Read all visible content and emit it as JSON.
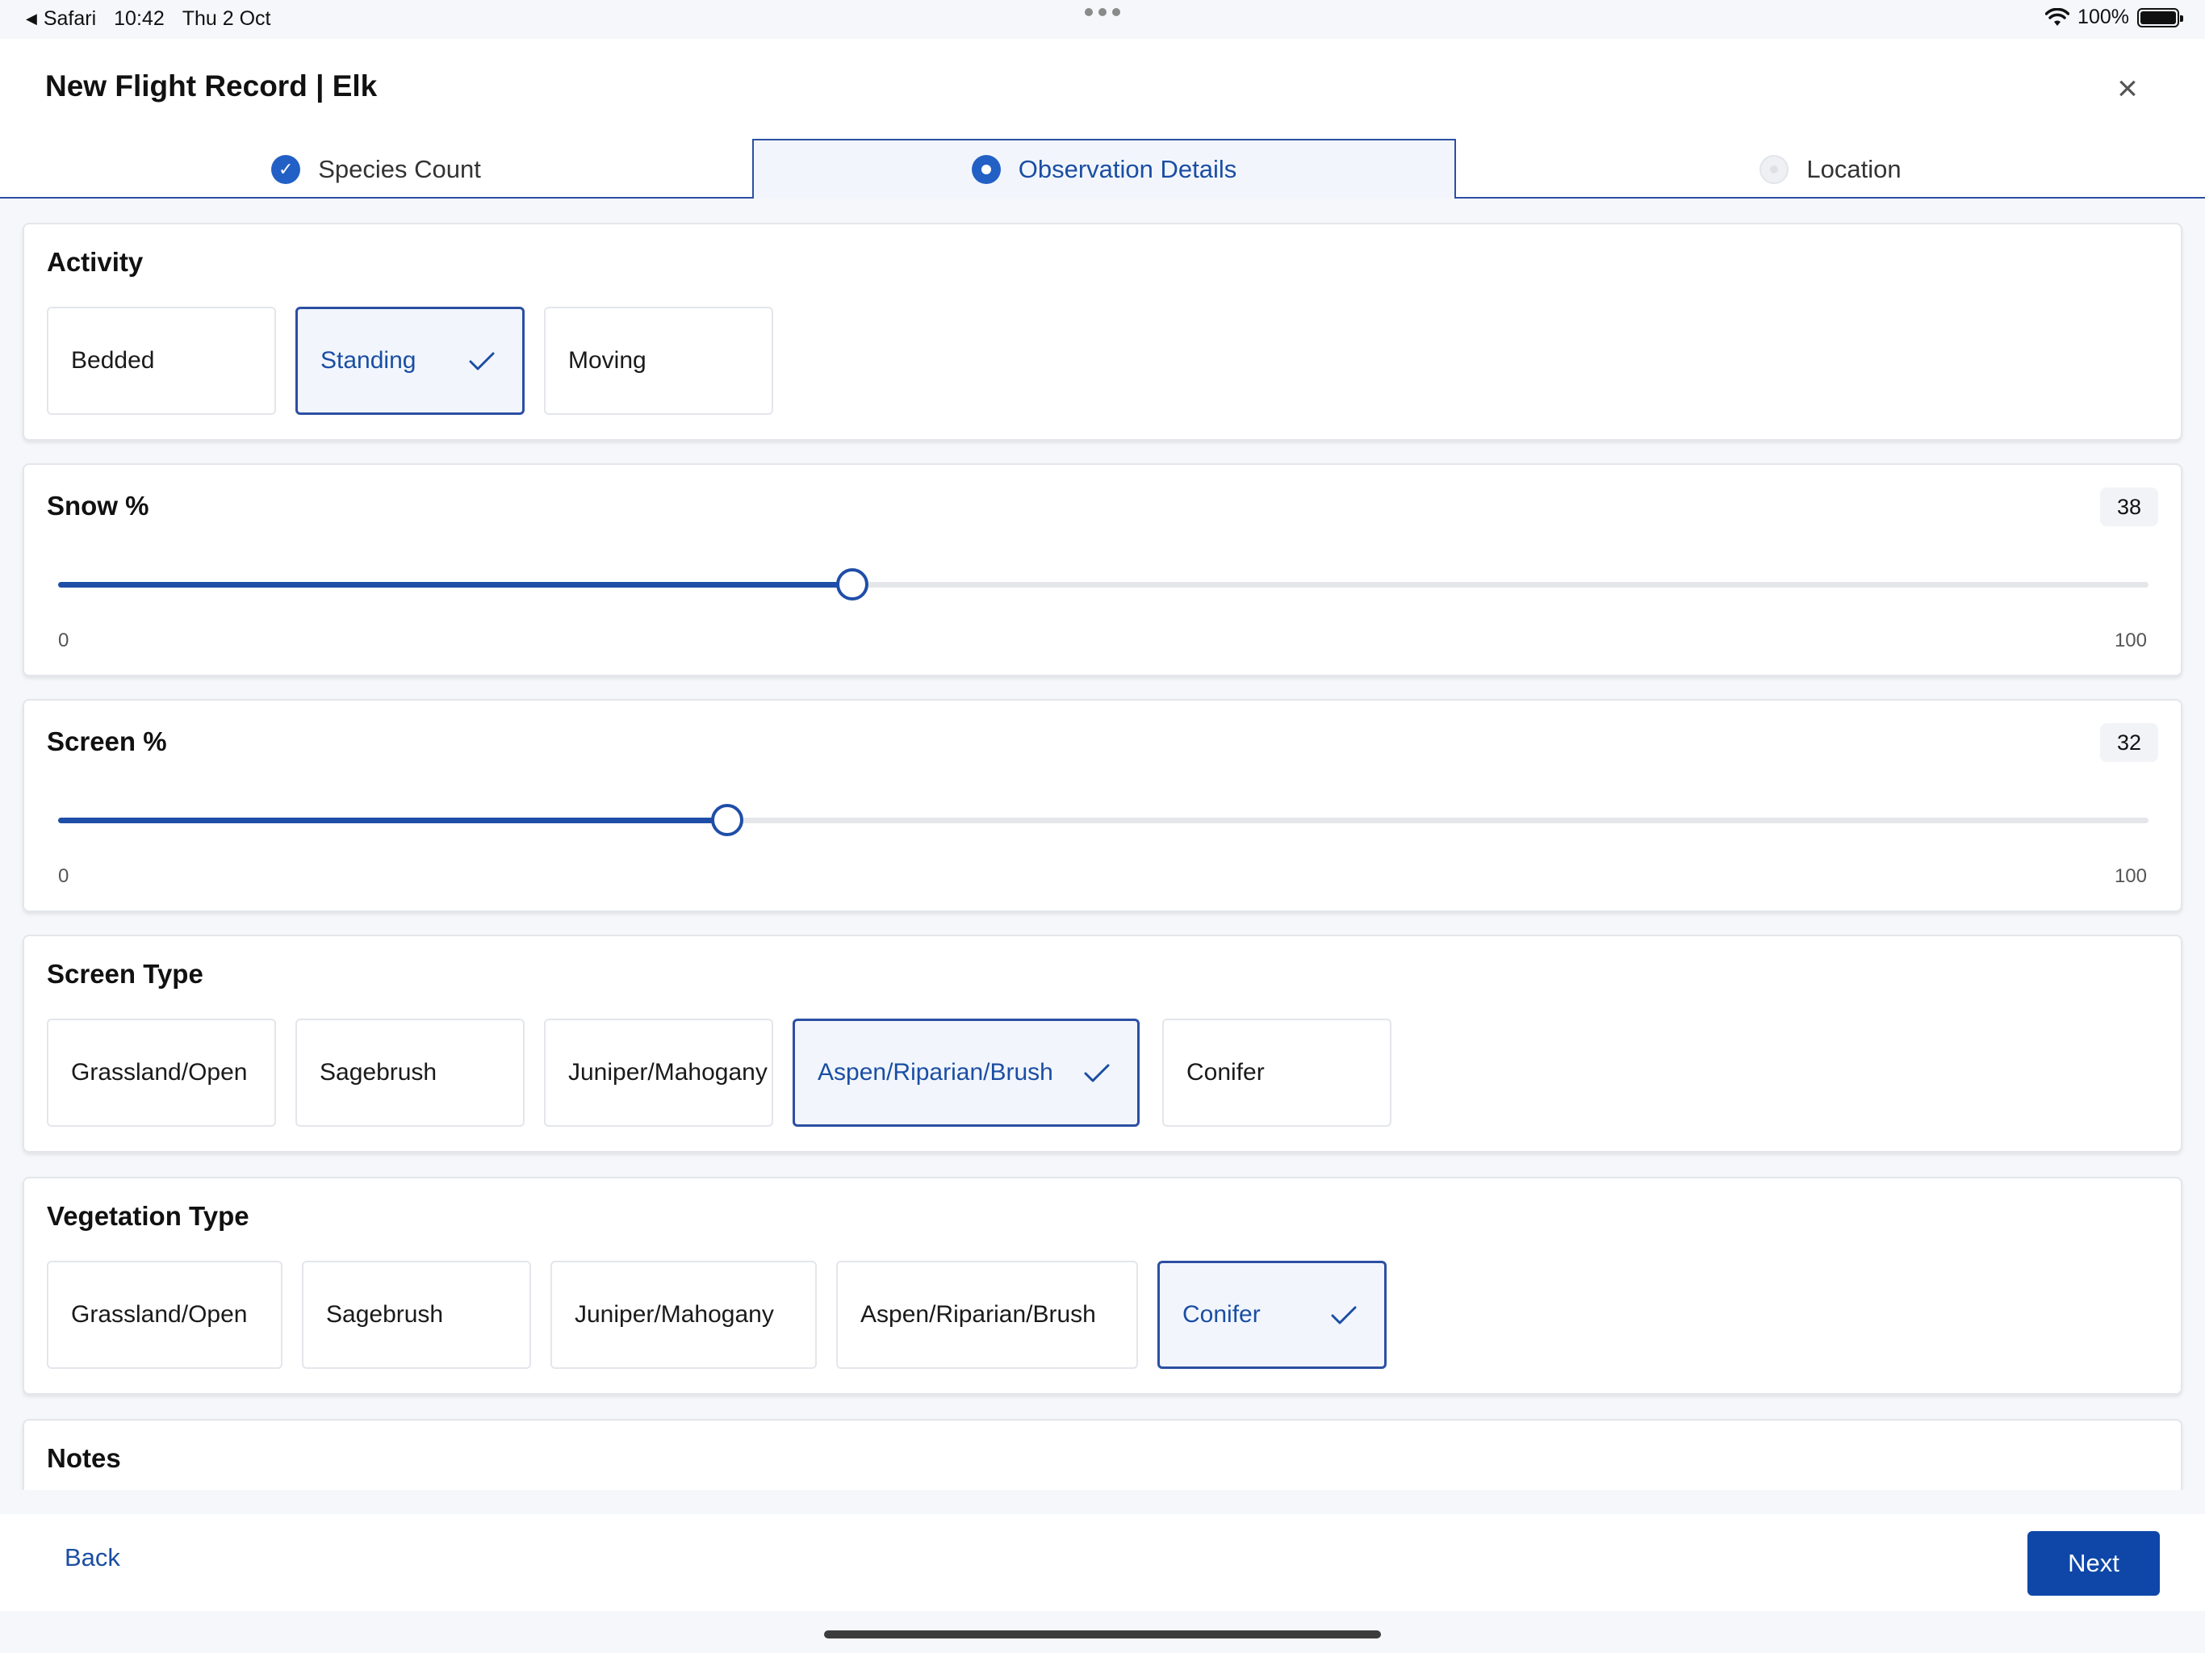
{
  "status_bar": {
    "back_app": "Safari",
    "time": "10:42",
    "date": "Thu 2 Oct",
    "battery": "100%"
  },
  "header": {
    "title": "New Flight Record | Elk",
    "close_icon": "close-icon"
  },
  "tabs": [
    {
      "label": "Species Count",
      "state": "completed"
    },
    {
      "label": "Observation Details",
      "state": "current"
    },
    {
      "label": "Location",
      "state": "upcoming"
    }
  ],
  "activity": {
    "title": "Activity",
    "options": [
      {
        "label": "Bedded",
        "selected": false
      },
      {
        "label": "Standing",
        "selected": true
      },
      {
        "label": "Moving",
        "selected": false
      }
    ]
  },
  "snow": {
    "title": "Snow %",
    "value": "38",
    "min": "0",
    "max": "100"
  },
  "screen": {
    "title": "Screen %",
    "value": "32",
    "min": "0",
    "max": "100"
  },
  "screen_type": {
    "title": "Screen Type",
    "options": [
      {
        "label": "Grassland/Open",
        "selected": false
      },
      {
        "label": "Sagebrush",
        "selected": false
      },
      {
        "label": "Juniper/Mahogany",
        "selected": false
      },
      {
        "label": "Aspen/Riparian/Brush",
        "selected": true
      },
      {
        "label": "Conifer",
        "selected": false
      }
    ]
  },
  "vegetation_type": {
    "title": "Vegetation Type",
    "options": [
      {
        "label": "Grassland/Open",
        "selected": false
      },
      {
        "label": "Sagebrush",
        "selected": false
      },
      {
        "label": "Juniper/Mahogany",
        "selected": false
      },
      {
        "label": "Aspen/Riparian/Brush",
        "selected": false
      },
      {
        "label": "Conifer",
        "selected": true
      }
    ]
  },
  "notes": {
    "title": "Notes"
  },
  "footer": {
    "back_label": "Back",
    "next_label": "Next"
  },
  "colors": {
    "accent": "#1b4ea3",
    "primary_button": "#0e47a8",
    "selected_bg": "#f2f6fc"
  }
}
